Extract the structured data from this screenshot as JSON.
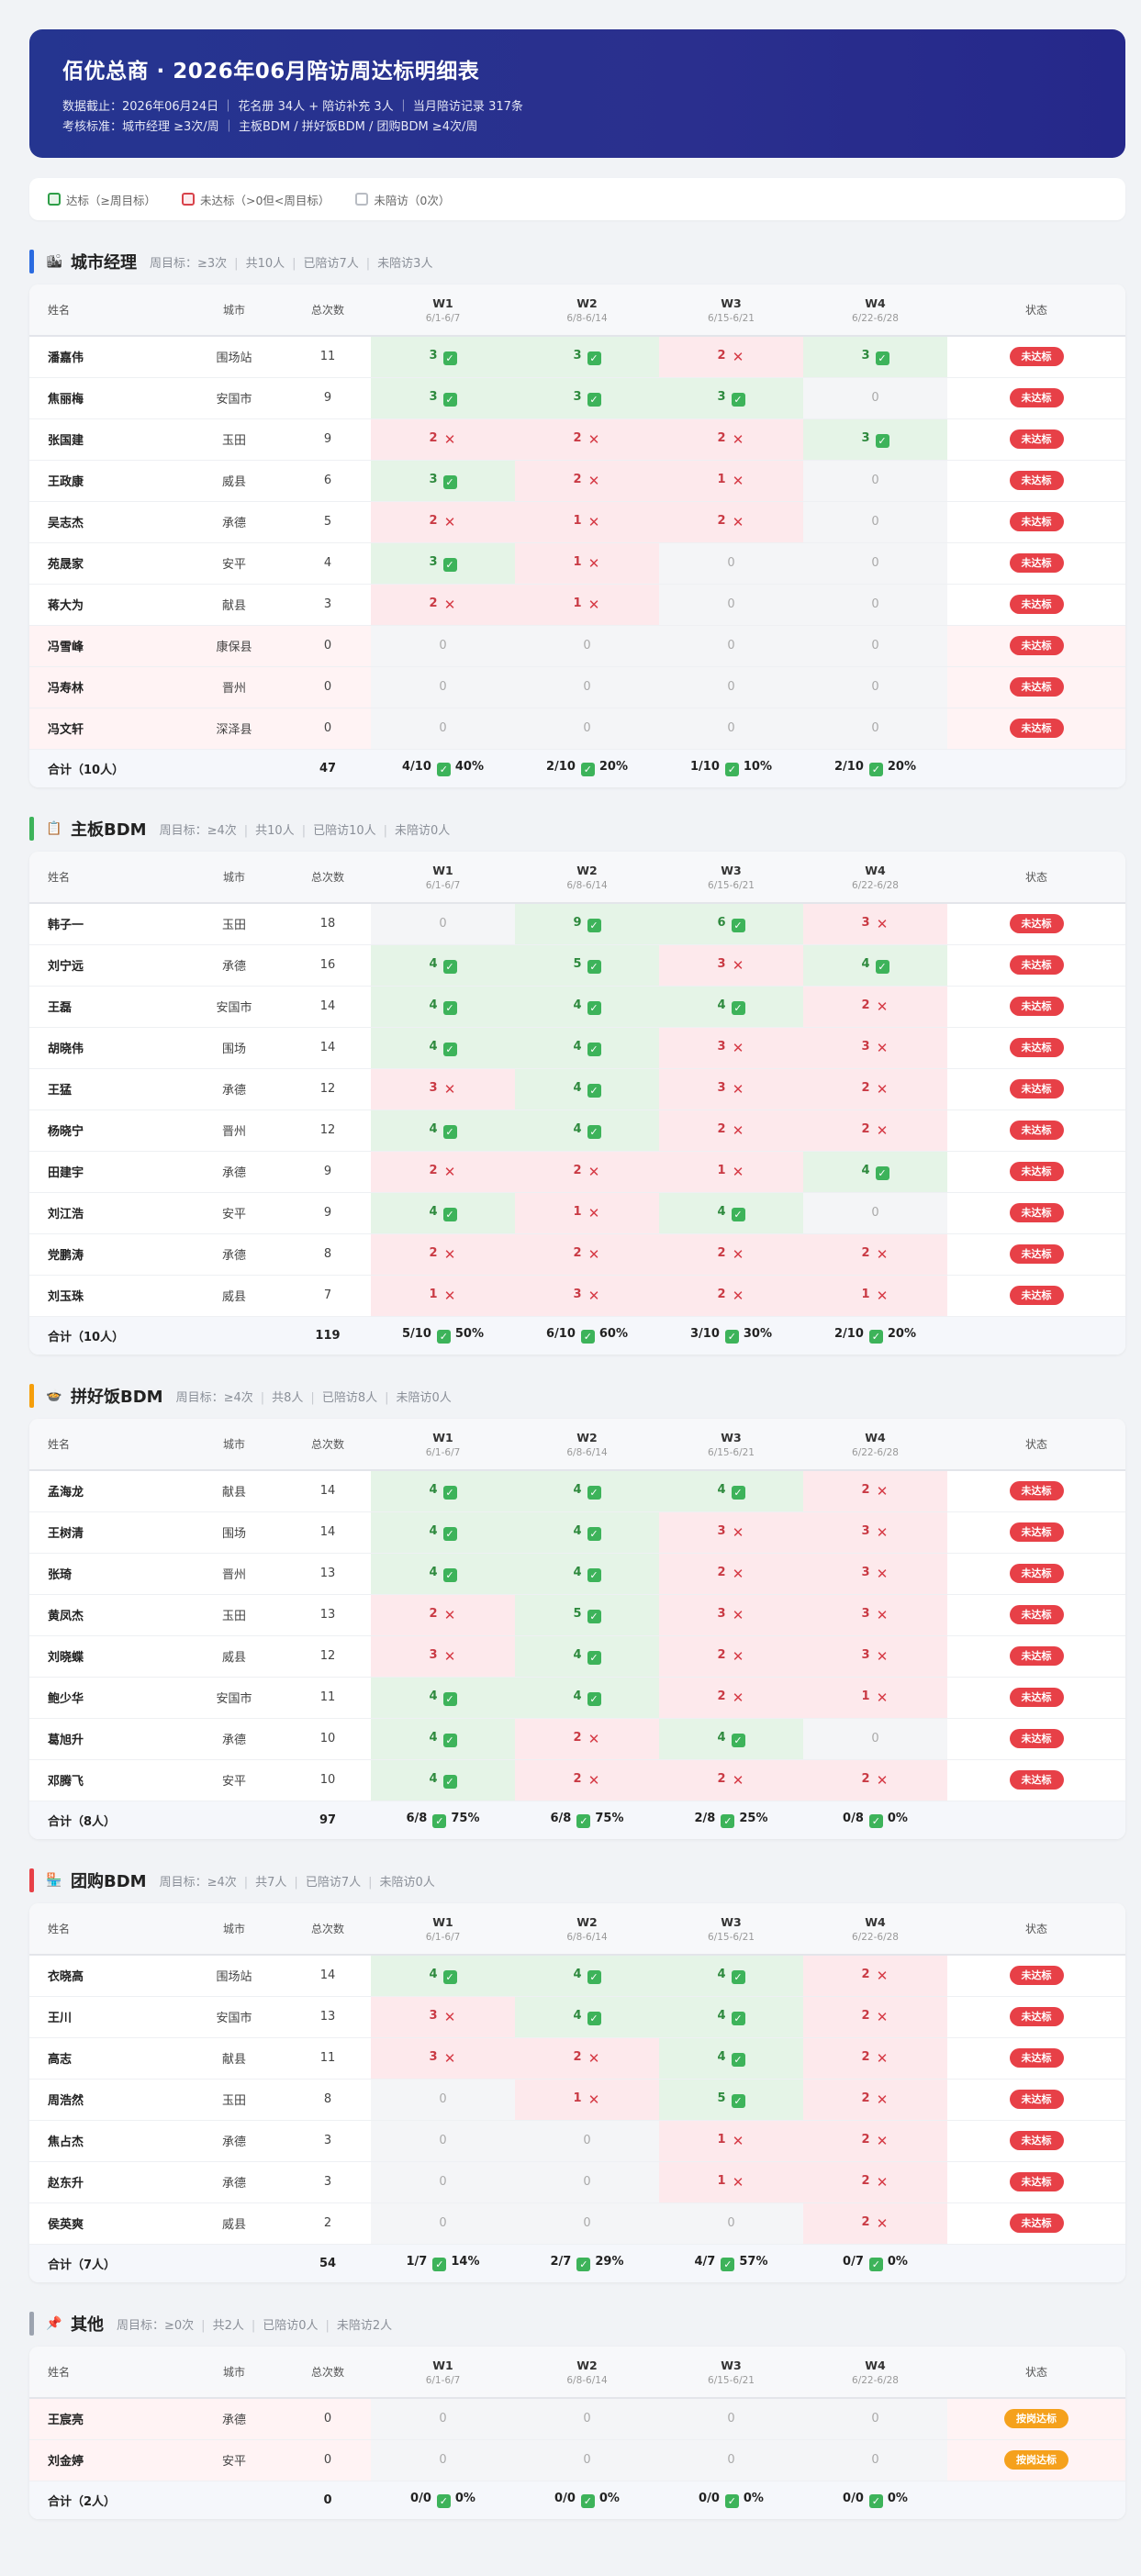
{
  "header": {
    "title": "佰优总商 · 2026年06月陪访周达标明细表",
    "meta_line1": "数据截止：2026年06月24日 ｜ 花名册 34人 + 陪访补充 3人 ｜ 当月陪访记录 317条",
    "meta_line2": "考核标准：城市经理 ≥3次/周 ｜ 主板BDM / 拼好饭BDM / 团购BDM ≥4次/周"
  },
  "legend": {
    "ok": "达标（≥周目标）",
    "no": "未达标（>0但<周目标）",
    "none": "未陪访（0次）"
  },
  "columns": {
    "name": "姓名",
    "city": "城市",
    "total": "总次数",
    "status": "状态",
    "weeks": [
      {
        "label": "W1",
        "range": "6/1-6/7"
      },
      {
        "label": "W2",
        "range": "6/8-6/14"
      },
      {
        "label": "W3",
        "range": "6/15-6/21"
      },
      {
        "label": "W4",
        "range": "6/22-6/28"
      }
    ]
  },
  "colors": {
    "accent": "#2a2f8e",
    "ok": "#3db35a",
    "no": "#e74047",
    "warn": "#f5a11c"
  },
  "sections": [
    {
      "name": "城市经理",
      "icon": "city-icon",
      "bar_color": "#2b6be0",
      "meta": [
        "周目标：≥3次",
        "共10人",
        "已陪访7人",
        "未陪访3人"
      ],
      "target": 3,
      "rows": [
        {
          "name": "潘嘉伟",
          "city": "围场站",
          "total": "11",
          "weeks": [
            3,
            3,
            2,
            3
          ],
          "status": "未达标",
          "badge": "red"
        },
        {
          "name": "焦丽梅",
          "city": "安国市",
          "total": "9",
          "weeks": [
            3,
            3,
            3,
            0
          ],
          "status": "未达标",
          "badge": "red"
        },
        {
          "name": "张国建",
          "city": "玉田",
          "total": "9",
          "weeks": [
            2,
            2,
            2,
            3
          ],
          "status": "未达标",
          "badge": "red"
        },
        {
          "name": "王政康",
          "city": "威县",
          "total": "6",
          "weeks": [
            3,
            2,
            1,
            0
          ],
          "status": "未达标",
          "badge": "red"
        },
        {
          "name": "吴志杰",
          "city": "承德",
          "total": "5",
          "weeks": [
            2,
            1,
            2,
            0
          ],
          "status": "未达标",
          "badge": "red"
        },
        {
          "name": "苑晟家",
          "city": "安平",
          "total": "4",
          "weeks": [
            3,
            1,
            0,
            0
          ],
          "status": "未达标",
          "badge": "red"
        },
        {
          "name": "蒋大为",
          "city": "献县",
          "total": "3",
          "weeks": [
            2,
            1,
            0,
            0
          ],
          "status": "未达标",
          "badge": "red"
        },
        {
          "name": "冯雪峰",
          "city": "康保县",
          "total": "0",
          "weeks": [
            0,
            0,
            0,
            0
          ],
          "status": "未达标",
          "badge": "red"
        },
        {
          "name": "冯寿林",
          "city": "晋州",
          "total": "0",
          "weeks": [
            0,
            0,
            0,
            0
          ],
          "status": "未达标",
          "badge": "red"
        },
        {
          "name": "冯文轩",
          "city": "深泽县",
          "total": "0",
          "weeks": [
            0,
            0,
            0,
            0
          ],
          "status": "未达标",
          "badge": "red"
        }
      ],
      "footer": {
        "label": "合计（10人）",
        "total": "47",
        "weeks": [
          {
            "frac": "4/10",
            "pct": "40%"
          },
          {
            "frac": "2/10",
            "pct": "20%"
          },
          {
            "frac": "1/10",
            "pct": "10%"
          },
          {
            "frac": "2/10",
            "pct": "20%"
          }
        ]
      }
    },
    {
      "name": "主板BDM",
      "icon": "clipboard-icon",
      "bar_color": "#3db35a",
      "meta": [
        "周目标：≥4次",
        "共10人",
        "已陪访10人",
        "未陪访0人"
      ],
      "target": 4,
      "rows": [
        {
          "name": "韩子一",
          "city": "玉田",
          "total": "18",
          "weeks": [
            0,
            9,
            6,
            3
          ],
          "status": "未达标",
          "badge": "red"
        },
        {
          "name": "刘宁远",
          "city": "承德",
          "total": "16",
          "weeks": [
            4,
            5,
            3,
            4
          ],
          "status": "未达标",
          "badge": "red"
        },
        {
          "name": "王磊",
          "city": "安国市",
          "total": "14",
          "weeks": [
            4,
            4,
            4,
            2
          ],
          "status": "未达标",
          "badge": "red"
        },
        {
          "name": "胡晓伟",
          "city": "围场",
          "total": "14",
          "weeks": [
            4,
            4,
            3,
            3
          ],
          "status": "未达标",
          "badge": "red"
        },
        {
          "name": "王猛",
          "city": "承德",
          "total": "12",
          "weeks": [
            3,
            4,
            3,
            2
          ],
          "status": "未达标",
          "badge": "red"
        },
        {
          "name": "杨晓宁",
          "city": "晋州",
          "total": "12",
          "weeks": [
            4,
            4,
            2,
            2
          ],
          "status": "未达标",
          "badge": "red"
        },
        {
          "name": "田建宇",
          "city": "承德",
          "total": "9",
          "weeks": [
            2,
            2,
            1,
            4
          ],
          "status": "未达标",
          "badge": "red"
        },
        {
          "name": "刘江浩",
          "city": "安平",
          "total": "9",
          "weeks": [
            4,
            1,
            4,
            0
          ],
          "status": "未达标",
          "badge": "red"
        },
        {
          "name": "党鹏涛",
          "city": "承德",
          "total": "8",
          "weeks": [
            2,
            2,
            2,
            2
          ],
          "status": "未达标",
          "badge": "red"
        },
        {
          "name": "刘玉珠",
          "city": "威县",
          "total": "7",
          "weeks": [
            1,
            3,
            2,
            1
          ],
          "status": "未达标",
          "badge": "red"
        }
      ],
      "footer": {
        "label": "合计（10人）",
        "total": "119",
        "weeks": [
          {
            "frac": "5/10",
            "pct": "50%"
          },
          {
            "frac": "6/10",
            "pct": "60%"
          },
          {
            "frac": "3/10",
            "pct": "30%"
          },
          {
            "frac": "2/10",
            "pct": "20%"
          }
        ]
      }
    },
    {
      "name": "拼好饭BDM",
      "icon": "food-bowl-icon",
      "bar_color": "#f59e0b",
      "meta": [
        "周目标：≥4次",
        "共8人",
        "已陪访8人",
        "未陪访0人"
      ],
      "target": 4,
      "rows": [
        {
          "name": "孟海龙",
          "city": "献县",
          "total": "14",
          "weeks": [
            4,
            4,
            4,
            2
          ],
          "status": "未达标",
          "badge": "red"
        },
        {
          "name": "王树清",
          "city": "围场",
          "total": "14",
          "weeks": [
            4,
            4,
            3,
            3
          ],
          "status": "未达标",
          "badge": "red"
        },
        {
          "name": "张琦",
          "city": "晋州",
          "total": "13",
          "weeks": [
            4,
            4,
            2,
            3
          ],
          "status": "未达标",
          "badge": "red"
        },
        {
          "name": "黄凤杰",
          "city": "玉田",
          "total": "13",
          "weeks": [
            2,
            5,
            3,
            3
          ],
          "status": "未达标",
          "badge": "red"
        },
        {
          "name": "刘晓蝶",
          "city": "威县",
          "total": "12",
          "weeks": [
            3,
            4,
            2,
            3
          ],
          "status": "未达标",
          "badge": "red"
        },
        {
          "name": "鲍少华",
          "city": "安国市",
          "total": "11",
          "weeks": [
            4,
            4,
            2,
            1
          ],
          "status": "未达标",
          "badge": "red"
        },
        {
          "name": "葛旭升",
          "city": "承德",
          "total": "10",
          "weeks": [
            4,
            2,
            4,
            0
          ],
          "status": "未达标",
          "badge": "red"
        },
        {
          "name": "邓腾飞",
          "city": "安平",
          "total": "10",
          "weeks": [
            4,
            2,
            2,
            2
          ],
          "status": "未达标",
          "badge": "red"
        }
      ],
      "footer": {
        "label": "合计（8人）",
        "total": "97",
        "weeks": [
          {
            "frac": "6/8",
            "pct": "75%"
          },
          {
            "frac": "6/8",
            "pct": "75%"
          },
          {
            "frac": "2/8",
            "pct": "25%"
          },
          {
            "frac": "0/8",
            "pct": "0%"
          }
        ]
      }
    },
    {
      "name": "团购BDM",
      "icon": "store-icon",
      "bar_color": "#e74047",
      "meta": [
        "周目标：≥4次",
        "共7人",
        "已陪访7人",
        "未陪访0人"
      ],
      "target": 4,
      "rows": [
        {
          "name": "衣晓高",
          "city": "围场站",
          "total": "14",
          "weeks": [
            4,
            4,
            4,
            2
          ],
          "status": "未达标",
          "badge": "red"
        },
        {
          "name": "王川",
          "city": "安国市",
          "total": "13",
          "weeks": [
            3,
            4,
            4,
            2
          ],
          "status": "未达标",
          "badge": "red"
        },
        {
          "name": "高志",
          "city": "献县",
          "total": "11",
          "weeks": [
            3,
            2,
            4,
            2
          ],
          "status": "未达标",
          "badge": "red"
        },
        {
          "name": "周浩然",
          "city": "玉田",
          "total": "8",
          "weeks": [
            0,
            1,
            5,
            2
          ],
          "status": "未达标",
          "badge": "red"
        },
        {
          "name": "焦占杰",
          "city": "承德",
          "total": "3",
          "weeks": [
            0,
            0,
            1,
            2
          ],
          "status": "未达标",
          "badge": "red"
        },
        {
          "name": "赵东升",
          "city": "承德",
          "total": "3",
          "weeks": [
            0,
            0,
            1,
            2
          ],
          "status": "未达标",
          "badge": "red"
        },
        {
          "name": "侯英爽",
          "city": "威县",
          "total": "2",
          "weeks": [
            0,
            0,
            0,
            2
          ],
          "status": "未达标",
          "badge": "red"
        }
      ],
      "footer": {
        "label": "合计（7人）",
        "total": "54",
        "weeks": [
          {
            "frac": "1/7",
            "pct": "14%"
          },
          {
            "frac": "2/7",
            "pct": "29%"
          },
          {
            "frac": "4/7",
            "pct": "57%"
          },
          {
            "frac": "0/7",
            "pct": "0%"
          }
        ]
      }
    },
    {
      "name": "其他",
      "icon": "pin-icon",
      "bar_color": "#9ca3af",
      "meta": [
        "周目标：≥0次",
        "共2人",
        "已陪访0人",
        "未陪访2人"
      ],
      "target": 0,
      "rows": [
        {
          "name": "王宸亮",
          "city": "承德",
          "total": "0",
          "weeks": [
            0,
            0,
            0,
            0
          ],
          "status": "按岗达标",
          "badge": "orange"
        },
        {
          "name": "刘金婷",
          "city": "安平",
          "total": "0",
          "weeks": [
            0,
            0,
            0,
            0
          ],
          "status": "按岗达标",
          "badge": "orange"
        }
      ],
      "footer": {
        "label": "合计（2人）",
        "total": "0",
        "weeks": [
          {
            "frac": "0/0",
            "pct": "0%"
          },
          {
            "frac": "0/0",
            "pct": "0%"
          },
          {
            "frac": "0/0",
            "pct": "0%"
          },
          {
            "frac": "0/0",
            "pct": "0%"
          }
        ]
      }
    }
  ]
}
